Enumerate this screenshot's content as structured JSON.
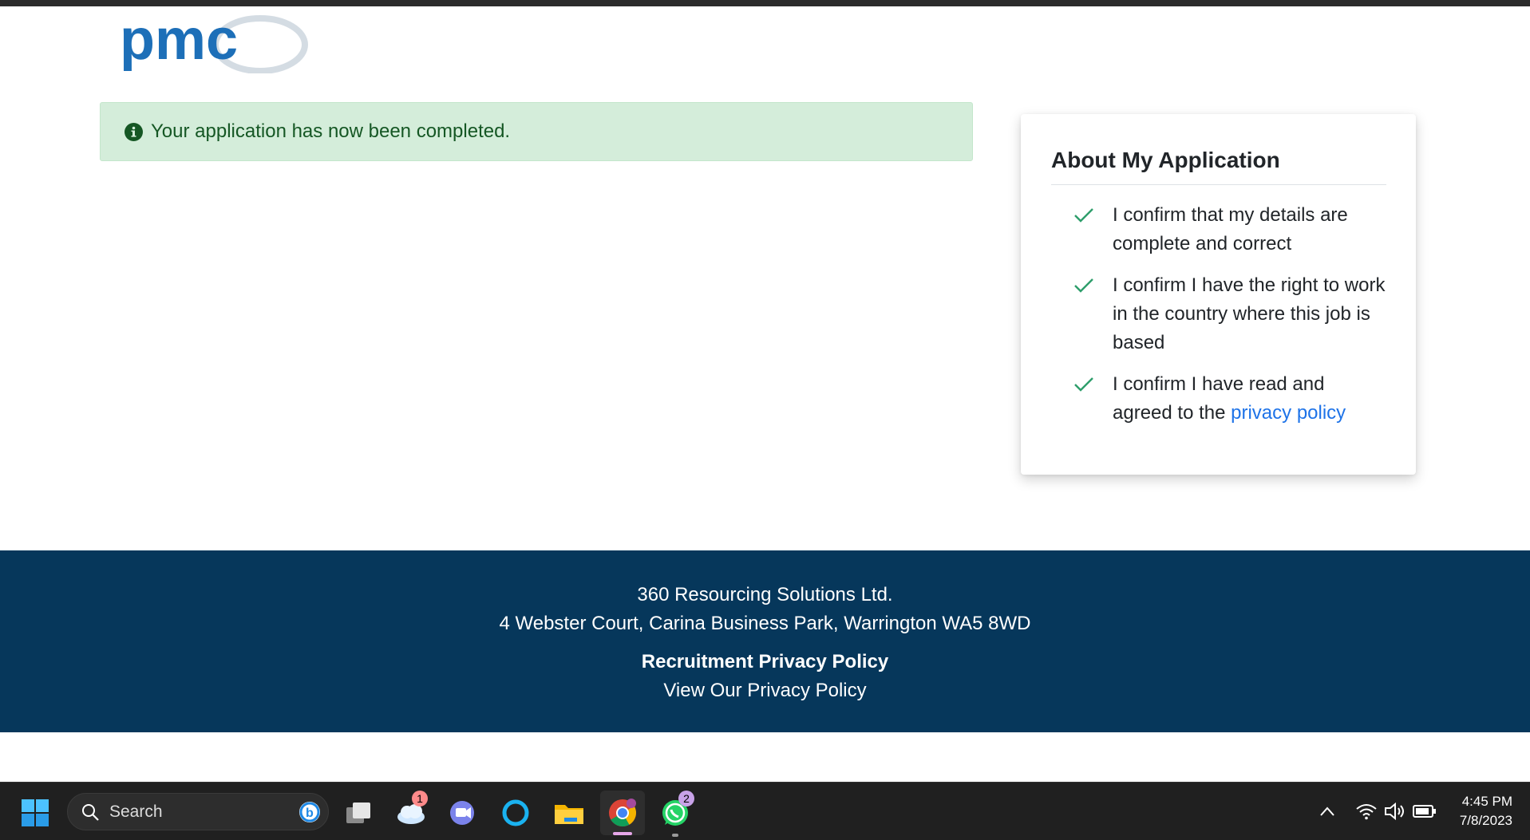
{
  "logo": {
    "text": "pmc"
  },
  "alert": {
    "message": "Your application has now been completed."
  },
  "about": {
    "title": "About My Application",
    "items": [
      {
        "text": "I confirm that my details are complete and correct"
      },
      {
        "text": "I confirm I have the right to work in the country where this job is based"
      },
      {
        "text": "I confirm I have read and agreed to the ",
        "link": "privacy policy"
      }
    ]
  },
  "footer": {
    "company": "360 Resourcing Solutions Ltd.",
    "address": "4 Webster Court, Carina Business Park, Warrington WA5 8WD",
    "policy_title": "Recruitment Privacy Policy",
    "policy_link": "View Our Privacy Policy"
  },
  "taskbar": {
    "search_placeholder": "Search",
    "weather_badge": "1",
    "whatsapp_badge": "2",
    "time": "4:45 PM",
    "date": "7/8/2023"
  },
  "colors": {
    "footer_bg": "#06375b",
    "alert_bg": "#d4edda",
    "alert_text": "#155724",
    "check": "#2e9e6b",
    "link": "#1e73e8",
    "logo_blue": "#1d6fb8"
  }
}
